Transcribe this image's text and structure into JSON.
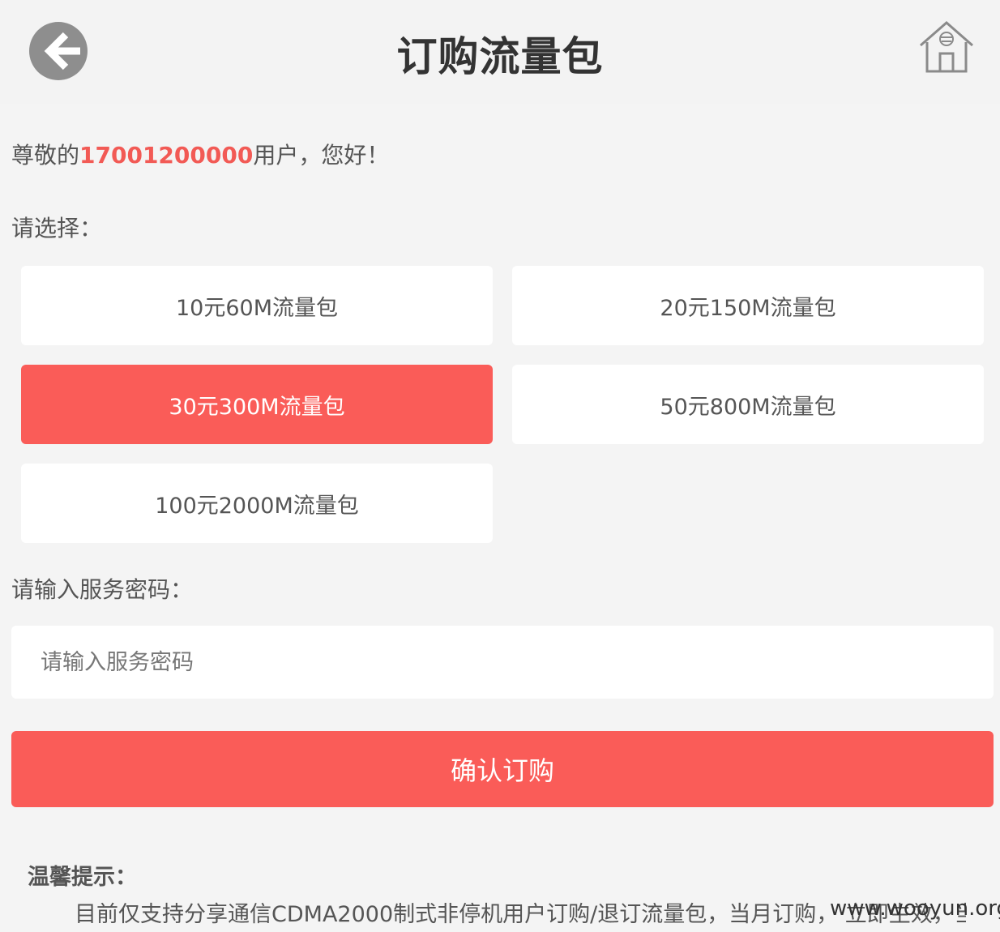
{
  "header": {
    "title": "订购流量包",
    "back_icon": "back-arrow-icon",
    "home_icon": "home-icon"
  },
  "greeting": {
    "prefix": "尊敬的",
    "phone": "17001200000",
    "suffix": "用户，您好！"
  },
  "select_label": "请选择：",
  "packages": [
    {
      "label": "10元60M流量包",
      "selected": false
    },
    {
      "label": "20元150M流量包",
      "selected": false
    },
    {
      "label": "30元300M流量包",
      "selected": true
    },
    {
      "label": "50元800M流量包",
      "selected": false
    },
    {
      "label": "100元2000M流量包",
      "selected": false
    }
  ],
  "password": {
    "label": "请输入服务密码：",
    "placeholder": "请输入服务密码",
    "value": ""
  },
  "confirm_button": "确认订购",
  "tips": {
    "title": "温馨提示：",
    "body": "目前仅支持分享通信CDMA2000制式非停机用户订购/退订流量包，当月订购， 立即生效，当月"
  },
  "watermark": "www.wooyun.org",
  "colors": {
    "accent": "#fa5c58",
    "phone": "#f25a55",
    "background": "#f4f4f4"
  }
}
